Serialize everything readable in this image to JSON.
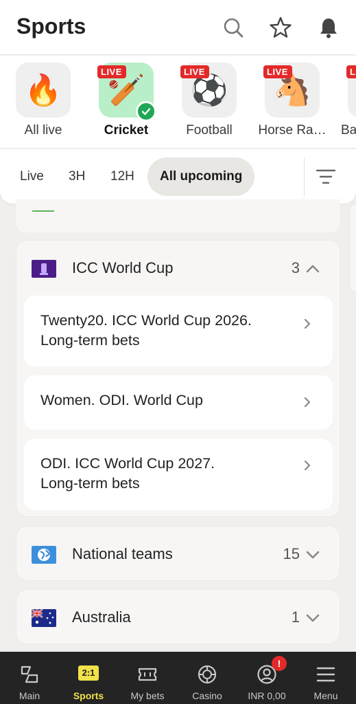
{
  "header": {
    "title": "Sports",
    "icons": [
      "search-icon",
      "star-icon",
      "bell-icon"
    ]
  },
  "sports": [
    {
      "label": "All live",
      "icon": "fire",
      "emoji": "🔥",
      "live": false,
      "active": false
    },
    {
      "label": "Cricket",
      "icon": "cricket",
      "emoji": "🏏",
      "live": true,
      "active": true
    },
    {
      "label": "Football",
      "icon": "football",
      "emoji": "⚽",
      "live": true,
      "active": false
    },
    {
      "label": "Horse Ra…",
      "icon": "horse",
      "emoji": "🐴",
      "live": true,
      "active": false
    },
    {
      "label": "Ba",
      "icon": "unknown",
      "emoji": "",
      "live": true,
      "active": false
    }
  ],
  "live_badge": "LIVE",
  "filters": {
    "tabs": [
      "Live",
      "3H",
      "12H",
      "All upcoming"
    ],
    "active": "All upcoming"
  },
  "groups": [
    {
      "name": "ICC World Cup",
      "count": "3",
      "expanded": true,
      "items": [
        {
          "line1": "Twenty20. ICC World Cup 2026.",
          "line2": "Long-term bets"
        },
        {
          "line1": "Women. ODI. World Cup",
          "line2": ""
        },
        {
          "line1": "ODI. ICC World Cup 2027.",
          "line2": "Long-term bets"
        }
      ]
    },
    {
      "name": "National teams",
      "count": "15",
      "expanded": false,
      "items": []
    },
    {
      "name": "Australia",
      "count": "1",
      "expanded": false,
      "items": []
    }
  ],
  "bottom_nav": [
    {
      "label": "Main",
      "icon": "main-icon",
      "active": false
    },
    {
      "label": "Sports",
      "icon": "sports-icon",
      "badge": "2:1",
      "active": true
    },
    {
      "label": "My bets",
      "icon": "ticket-icon",
      "active": false
    },
    {
      "label": "Casino",
      "icon": "casino-chip-icon",
      "active": false
    },
    {
      "label": "INR 0,00",
      "icon": "account-icon",
      "alert": "!",
      "active": false
    },
    {
      "label": "Menu",
      "icon": "menu-icon",
      "active": false
    }
  ],
  "colors": {
    "accent": "#f1e24a",
    "live": "#e32a2a",
    "check": "#1ea756",
    "active_tile": "#b9efc8",
    "nav_bg": "#242424"
  }
}
